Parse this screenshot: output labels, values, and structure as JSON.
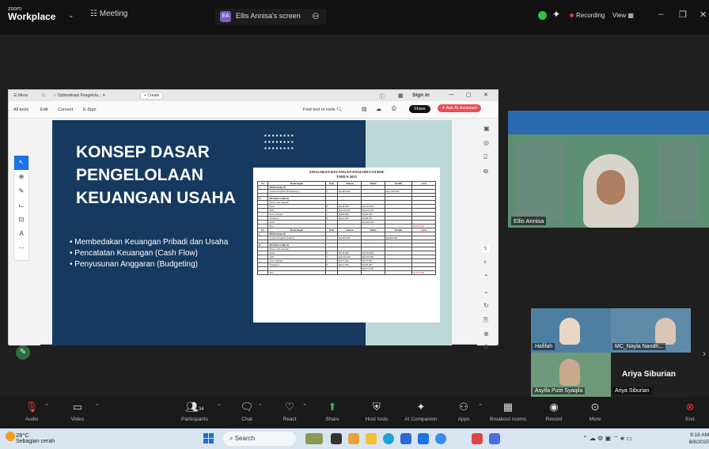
{
  "zoom": {
    "logo_top": "zoom",
    "logo_bottom": "Workplace",
    "meeting_label": "Meeting",
    "share_avatar": "EA",
    "share_title": "Ellis Annisa's screen",
    "recording_label": "Recording",
    "view_label": "View",
    "icons": [
      "chevron-down-icon",
      "meeting-icon",
      "shield-icon",
      "ai-spark-icon",
      "minimize-icon",
      "maximize-icon",
      "close-icon"
    ]
  },
  "browser": {
    "tabs": [
      "Menu",
      "Optimalisasi Pengelola...",
      "Create"
    ],
    "sign_in": "Sign in",
    "toolbar_items": [
      "All tools",
      "Edit",
      "Convert",
      "E-Sign"
    ],
    "find_text": "Find text or tools",
    "share_label": "Share",
    "ask_ai_label": "Ask AI Assistant",
    "page_number": "5"
  },
  "slide": {
    "title_lines": [
      "KONSEP DASAR",
      "PENGELOLAAN",
      "KEUANGAN USAHA"
    ],
    "bullets": [
      "Membedakan Keuangan Pribadi dan Usaha",
      "Pencatatan Keuangan (Cash Flow)",
      "Penyusunan Anggaran (Budgeting)"
    ]
  },
  "budget": {
    "title": "ANGGARAN KEUANGAN ENGLISH COURSE",
    "subtitle": "TAHUN 2025",
    "headers": [
      "No.",
      "Keterangan",
      "Unit",
      "Satuan",
      "Debet",
      "Kredit",
      "Saldo"
    ],
    "block1": [
      [
        "I",
        "PEMASUKAN",
        "",
        "",
        "",
        "",
        ""
      ],
      [
        "",
        "General English (Elementary)",
        "3",
        "Rp400.000",
        "",
        "Rp1.200.000",
        ""
      ],
      [
        "",
        "",
        "",
        "",
        "",
        "",
        ""
      ],
      [
        "II",
        "PENGELUARAN",
        "",
        "",
        "",
        "",
        ""
      ],
      [
        "",
        "Honor dan Insentif",
        "",
        "",
        "",
        "",
        ""
      ],
      [
        "",
        "Tutor",
        "8",
        "Rp40.000",
        "Rp320.000",
        "",
        ""
      ],
      [
        "",
        "ATK",
        "1",
        "Rp100.000",
        "Rp100.000",
        "",
        ""
      ],
      [
        "",
        "Sewa Tempat",
        "1",
        "Rp60.000",
        "Rp60.000",
        "",
        ""
      ],
      [
        "",
        "Transport",
        "8",
        "Rp10.000",
        "Rp80.000",
        "",
        ""
      ],
      [
        "",
        "Total",
        "",
        "",
        "Rp560.000",
        "",
        ""
      ],
      [
        "",
        "Sisa",
        "",
        "",
        "",
        "",
        "Rp640.000"
      ]
    ],
    "block2": [
      [
        "I",
        "PEMASUKAN",
        "",
        "",
        "",
        "",
        ""
      ],
      [
        "",
        "General English (Junior)",
        "3",
        "Rp300.000",
        "",
        "Rp900.000",
        ""
      ],
      [
        "",
        "",
        "",
        "",
        "",
        "",
        ""
      ],
      [
        "II",
        "PENGELUARAN",
        "",
        "",
        "",
        "",
        ""
      ],
      [
        "",
        "Honor dan Insentif",
        "",
        "",
        "",
        "",
        ""
      ],
      [
        "",
        "Tutor",
        "8",
        "Rp40.000",
        "Rp320.000",
        "",
        ""
      ],
      [
        "",
        "ATK",
        "1",
        "Rp100.000",
        "Rp100.000",
        "",
        ""
      ],
      [
        "",
        "Sewa Tempat",
        "1",
        "Rp75.000",
        "Rp75.000",
        "",
        ""
      ],
      [
        "",
        "Transport",
        "8",
        "Rp10.000",
        "Rp80.000",
        "",
        ""
      ],
      [
        "",
        "",
        "",
        "",
        "Rp575.000",
        "",
        ""
      ],
      [
        "",
        "Sisa",
        "",
        "",
        "",
        "",
        "Rp325.000"
      ]
    ]
  },
  "participants": {
    "main_name": "Ellis Annisa",
    "tiles": [
      "Hafifah",
      "MC_Nayla Nandh...",
      "Asyifa Putri Syaqila",
      "Ariya Siburian"
    ],
    "big_name": "Ariya Siburian"
  },
  "controls": [
    {
      "label": "Audio",
      "icon": "mic-muted-icon"
    },
    {
      "label": "Video",
      "icon": "video-icon"
    },
    {
      "label": "Participants",
      "icon": "participants-icon",
      "count": "34"
    },
    {
      "label": "Chat",
      "icon": "chat-icon"
    },
    {
      "label": "React",
      "icon": "react-icon"
    },
    {
      "label": "Share",
      "icon": "share-icon"
    },
    {
      "label": "Host tools",
      "icon": "shield-icon"
    },
    {
      "label": "AI Companion",
      "icon": "ai-companion-icon"
    },
    {
      "label": "Apps",
      "icon": "apps-icon"
    },
    {
      "label": "Breakout rooms",
      "icon": "breakout-icon"
    },
    {
      "label": "Record",
      "icon": "record-icon"
    },
    {
      "label": "More",
      "icon": "more-icon"
    },
    {
      "label": "End",
      "icon": "end-icon"
    }
  ],
  "taskbar": {
    "temp": "28°C",
    "weather": "Sebagian cerah",
    "search": "Search",
    "time": "9:18 AM",
    "date": "8/8/2025"
  }
}
